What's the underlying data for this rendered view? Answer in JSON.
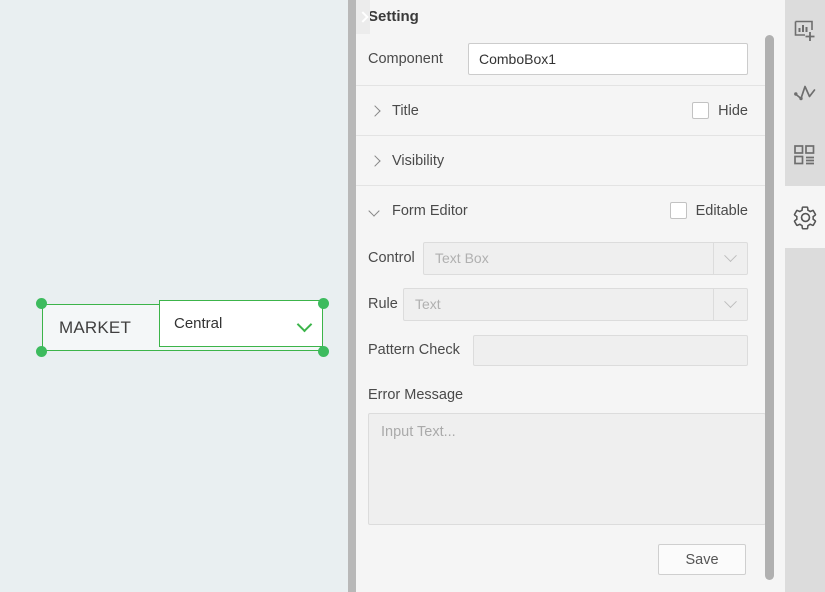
{
  "canvas": {
    "component": {
      "label": "MARKET",
      "dropdown_value": "Central",
      "selection_color": "#3dbb5e",
      "border_color": "#3cb44a",
      "background": "#e9eff1"
    }
  },
  "splitter": {
    "collapse_icon": "chevron-right-icon"
  },
  "panel": {
    "title": "Setting",
    "component": {
      "label": "Component",
      "value": "ComboBox1",
      "placeholder": ""
    },
    "sections": [
      {
        "label": "Title",
        "expanded": false,
        "caret": "chevron-right-icon",
        "checkbox_label": "Hide",
        "checked": false
      },
      {
        "label": "Visibility",
        "expanded": false,
        "caret": "chevron-right-icon",
        "checkbox_label": "",
        "checked": false
      },
      {
        "label": "Form Editor",
        "expanded": true,
        "caret": "chevron-down-icon",
        "checkbox_label": "Editable",
        "checked": false
      }
    ],
    "form_editor": {
      "control": {
        "label": "Control",
        "value": "Text Box",
        "disabled": true
      },
      "rule": {
        "label": "Rule",
        "value": "Text",
        "disabled": true
      },
      "pattern_check": {
        "label": "Pattern Check",
        "value": "",
        "placeholder": ""
      },
      "error_message": {
        "label": "Error Message",
        "value": "",
        "placeholder": "Input Text..."
      },
      "save_label": "Save"
    }
  },
  "rail": {
    "items": [
      {
        "icon": "add-chart-icon",
        "active": false
      },
      {
        "icon": "line-chart-icon",
        "active": false
      },
      {
        "icon": "grid-layout-icon",
        "active": false
      },
      {
        "icon": "gear-icon",
        "active": true
      }
    ]
  }
}
